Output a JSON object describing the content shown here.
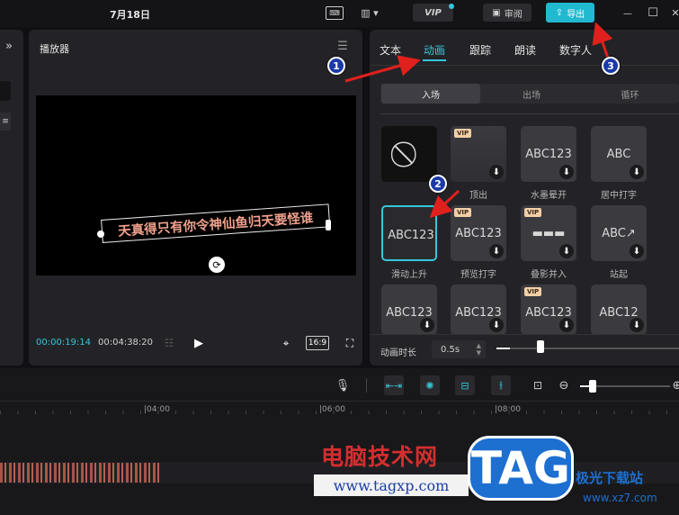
{
  "titlebar": {
    "date": "7月18日",
    "vip_label": "VIP",
    "review_label": "审阅",
    "export_label": "导出",
    "minimize": "—",
    "maximize": "☐",
    "close": "✕"
  },
  "player": {
    "title": "播放器",
    "subtitle_text": "天真得只有你令神仙鱼归天要怪谁",
    "current_time": "00:00:19:14",
    "total_time": "00:04:38:20",
    "ratio_label": "16:9"
  },
  "right_panel": {
    "tabs": [
      {
        "label": "文本",
        "active": false
      },
      {
        "label": "动画",
        "active": true
      },
      {
        "label": "跟踪",
        "active": false
      },
      {
        "label": "朗读",
        "active": false
      },
      {
        "label": "数字人",
        "active": false
      }
    ],
    "segments": [
      {
        "label": "入场",
        "active": true
      },
      {
        "label": "出场",
        "active": false
      },
      {
        "label": "循环",
        "active": false
      }
    ],
    "animations": [
      {
        "thumb": "⃠",
        "caption": "",
        "vip": false,
        "download": false,
        "selected": false
      },
      {
        "thumb": "",
        "caption": "顶出",
        "vip": true,
        "download": true,
        "selected": false
      },
      {
        "thumb": "ABC123",
        "caption": "水墨晕开",
        "vip": false,
        "download": true,
        "selected": false
      },
      {
        "thumb": "ABC",
        "caption": "居中打字",
        "vip": false,
        "download": true,
        "selected": false
      },
      {
        "thumb": "ABC123",
        "caption": "滑动上升",
        "vip": false,
        "download": false,
        "selected": true
      },
      {
        "thumb": "ABC123",
        "caption": "预览打字",
        "vip": true,
        "download": true,
        "selected": false
      },
      {
        "thumb": "▬▬▬",
        "caption": "叠影并入",
        "vip": true,
        "download": true,
        "selected": false
      },
      {
        "thumb": "ABC↗",
        "caption": "站起",
        "vip": false,
        "download": true,
        "selected": false
      },
      {
        "thumb": "ABC123",
        "caption": "",
        "vip": false,
        "download": true,
        "selected": false
      },
      {
        "thumb": "ABC123",
        "caption": "",
        "vip": false,
        "download": true,
        "selected": false
      },
      {
        "thumb": "ABC123",
        "caption": "",
        "vip": true,
        "download": true,
        "selected": false
      },
      {
        "thumb": "ABC12",
        "caption": "",
        "vip": false,
        "download": true,
        "selected": false
      }
    ],
    "duration_label": "动画时长",
    "duration_value": "0.5s",
    "duration_fraction": 0.3
  },
  "timeline": {
    "ticks": [
      "|04:00",
      "|06:00",
      "|08:00"
    ]
  },
  "watermark": {
    "site_name": "电脑技术网",
    "url": "www.tagxp.com",
    "logo_text": "TAG",
    "right_text": "极光下载站",
    "right_url": "www.xz7.com"
  },
  "markers": [
    "1",
    "2",
    "3"
  ],
  "colors": {
    "accent": "#35c7d8",
    "marker": "#1b3aa8",
    "arrow": "#e0201c"
  }
}
